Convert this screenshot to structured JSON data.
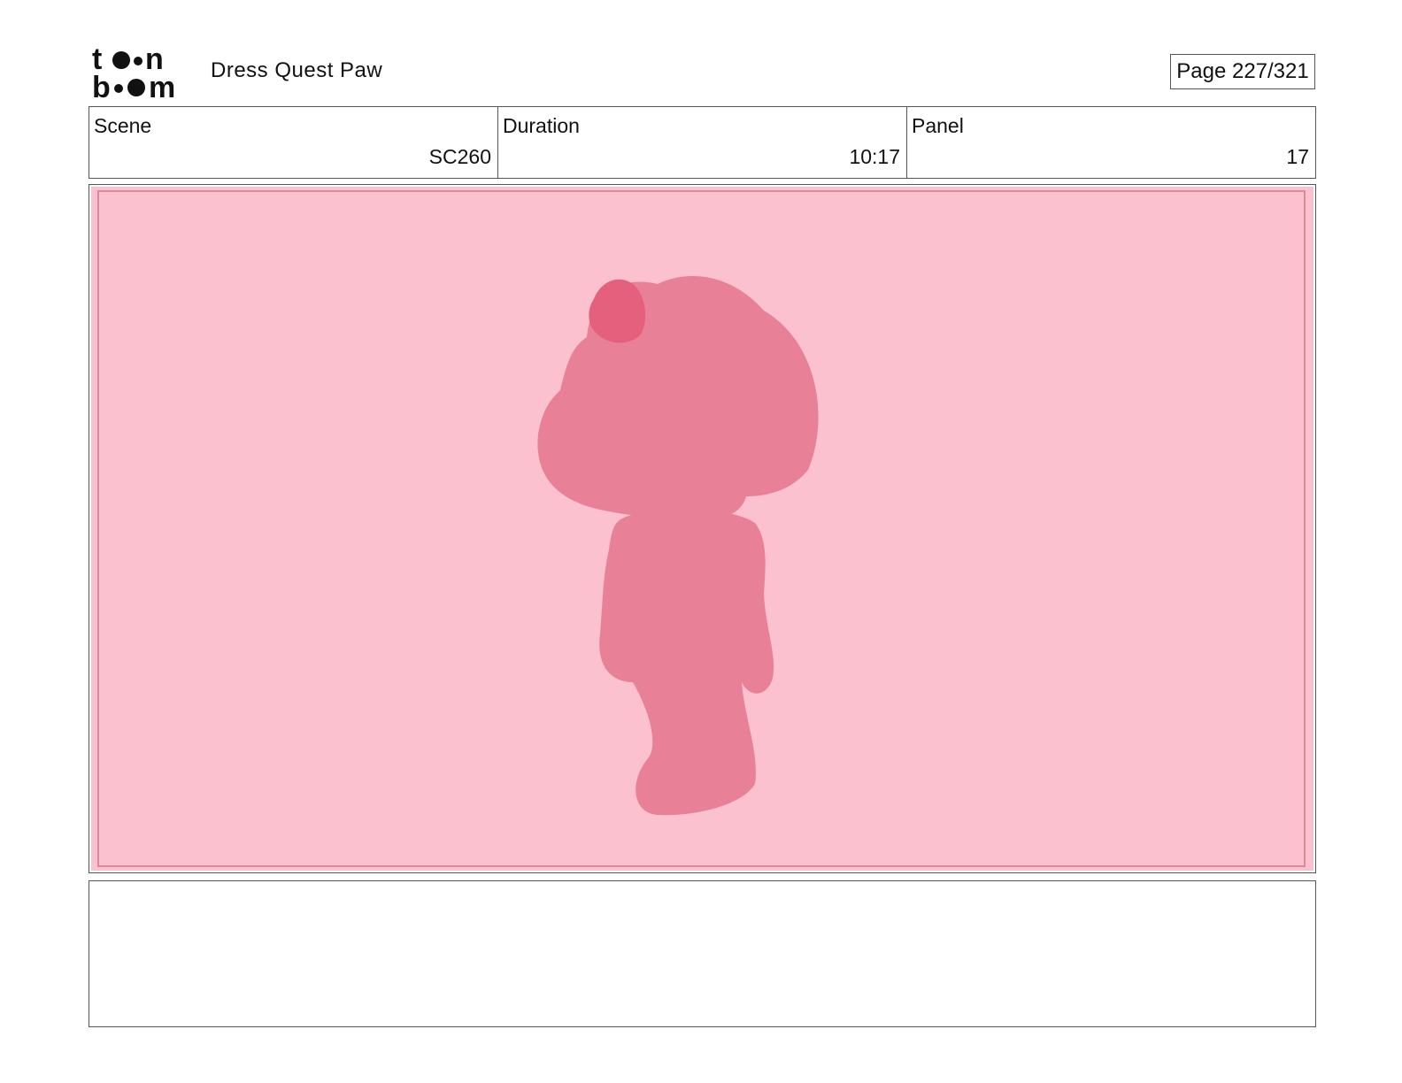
{
  "header": {
    "logo_text": "toon boom",
    "project_title": "Dress Quest Paw",
    "page_label": "Page 227/321"
  },
  "info": {
    "scene_label": "Scene",
    "scene_value": "SC260",
    "duration_label": "Duration",
    "duration_value": "10:17",
    "panel_label": "Panel",
    "panel_value": "17"
  },
  "panel": {
    "background_color": "#fbc1cf",
    "silhouette_color": "#e88097",
    "bow_color": "#e5607c"
  },
  "caption": {
    "text": ""
  }
}
